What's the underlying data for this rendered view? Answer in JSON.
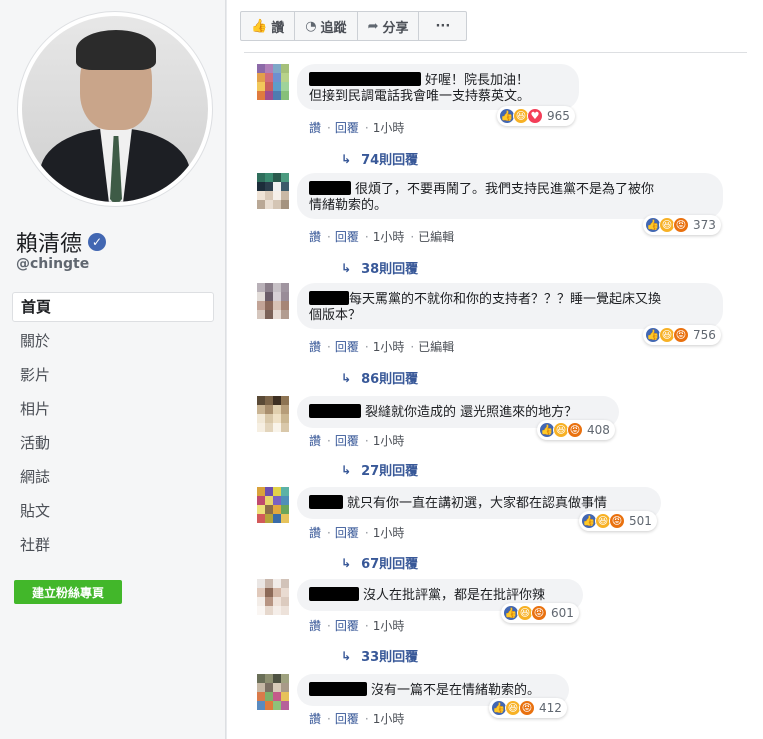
{
  "page": {
    "name": "賴清德",
    "handle": "@chingte",
    "verified_icon": "verified-check-icon",
    "nav": [
      {
        "label": "首頁",
        "active": true
      },
      {
        "label": "關於"
      },
      {
        "label": "影片"
      },
      {
        "label": "相片"
      },
      {
        "label": "活動"
      },
      {
        "label": "網誌"
      },
      {
        "label": "貼文"
      },
      {
        "label": "社群"
      }
    ],
    "create_page_button": "建立粉絲專頁",
    "accent_green": "#42b72a",
    "link_blue": "#385898"
  },
  "actions": {
    "like": "讚",
    "follow": "追蹤",
    "share": "分享",
    "more": "···"
  },
  "comment_meta": {
    "like": "讚",
    "reply": "回覆",
    "edited": "已編輯"
  },
  "comments": [
    {
      "text": "好喔！院長加油！\n但接到民調電話我會唯一支持蔡英文。",
      "line1": "好喔！院長加油！",
      "line2": "但接到民調電話我會唯一支持蔡英文。",
      "time": "1小時",
      "reacts": [
        "like",
        "haha",
        "love"
      ],
      "count": "965",
      "replies": "74則回覆"
    },
    {
      "line1": "很煩了，不要再鬧了。我們支持民進黨不是為了被你",
      "line2": "情緒勒索的。",
      "time": "1小時",
      "edited": true,
      "reacts": [
        "like",
        "haha",
        "angry"
      ],
      "count": "373",
      "replies": "38則回覆"
    },
    {
      "line1": "每天罵黨的不就你和你的支持者？？？睡一覺起床又換",
      "line2": "個版本？",
      "time": "1小時",
      "edited": true,
      "reacts": [
        "like",
        "haha",
        "angry"
      ],
      "count": "756",
      "replies": "86則回覆"
    },
    {
      "line1": "裂縫就你造成的 還光照進來的地方？",
      "time": "1小時",
      "reacts": [
        "like",
        "haha",
        "angry"
      ],
      "count": "408",
      "replies": "27則回覆"
    },
    {
      "line1": "就只有你一直在講初選，大家都在認真做事情",
      "time": "1小時",
      "reacts": [
        "like",
        "haha",
        "angry"
      ],
      "count": "501",
      "replies": "67則回覆"
    },
    {
      "line1": "沒人在批評黨，都是在批評你辣",
      "time": "1小時",
      "reacts": [
        "like",
        "haha",
        "angry"
      ],
      "count": "601",
      "replies": "33則回覆"
    },
    {
      "line1": "沒有一篇不是在情緒勒索的。",
      "time": "1小時",
      "reacts": [
        "like",
        "haha",
        "angry"
      ],
      "count": "412"
    }
  ]
}
